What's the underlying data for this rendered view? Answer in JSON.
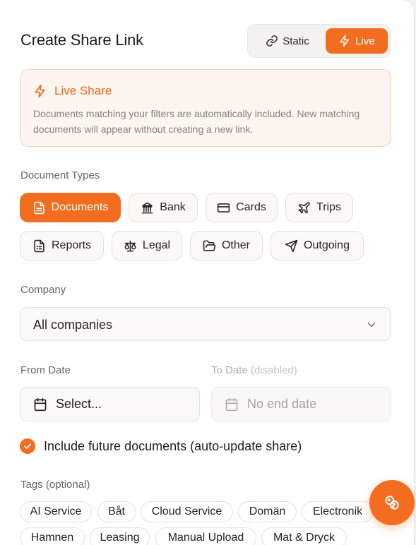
{
  "header": {
    "title": "Create Share Link",
    "mode_static": "Static",
    "mode_live": "Live"
  },
  "info": {
    "title": "Live Share",
    "text": "Documents matching your filters are automatically included. New matching documents will appear without creating a new link."
  },
  "document_types": {
    "label": "Document Types",
    "items": [
      {
        "label": "Documents",
        "icon": "document-icon",
        "selected": true
      },
      {
        "label": "Bank",
        "icon": "bank-icon",
        "selected": false
      },
      {
        "label": "Cards",
        "icon": "card-icon",
        "selected": false
      },
      {
        "label": "Trips",
        "icon": "plane-icon",
        "selected": false
      },
      {
        "label": "Reports",
        "icon": "report-icon",
        "selected": false
      },
      {
        "label": "Legal",
        "icon": "scales-icon",
        "selected": false
      },
      {
        "label": "Other",
        "icon": "folder-icon",
        "selected": false
      },
      {
        "label": "Outgoing",
        "icon": "send-icon",
        "selected": false
      }
    ]
  },
  "company": {
    "label": "Company",
    "value": "All companies"
  },
  "dates": {
    "from_label": "From Date",
    "from_value": "Select...",
    "to_label": "To Date",
    "to_note": "(disabled)",
    "to_value": "No end date"
  },
  "auto_update": {
    "label": "Include future documents (auto-update share)",
    "checked": true
  },
  "tags": {
    "label": "Tags (optional)",
    "items": [
      "AI Service",
      "Båt",
      "Cloud Service",
      "Domän",
      "Electronik",
      "Hamnen",
      "Leasing",
      "Manual Upload",
      "Mat & Dryck"
    ]
  },
  "colors": {
    "accent": "#f26d1f",
    "info_bg": "#fdf5ef"
  }
}
